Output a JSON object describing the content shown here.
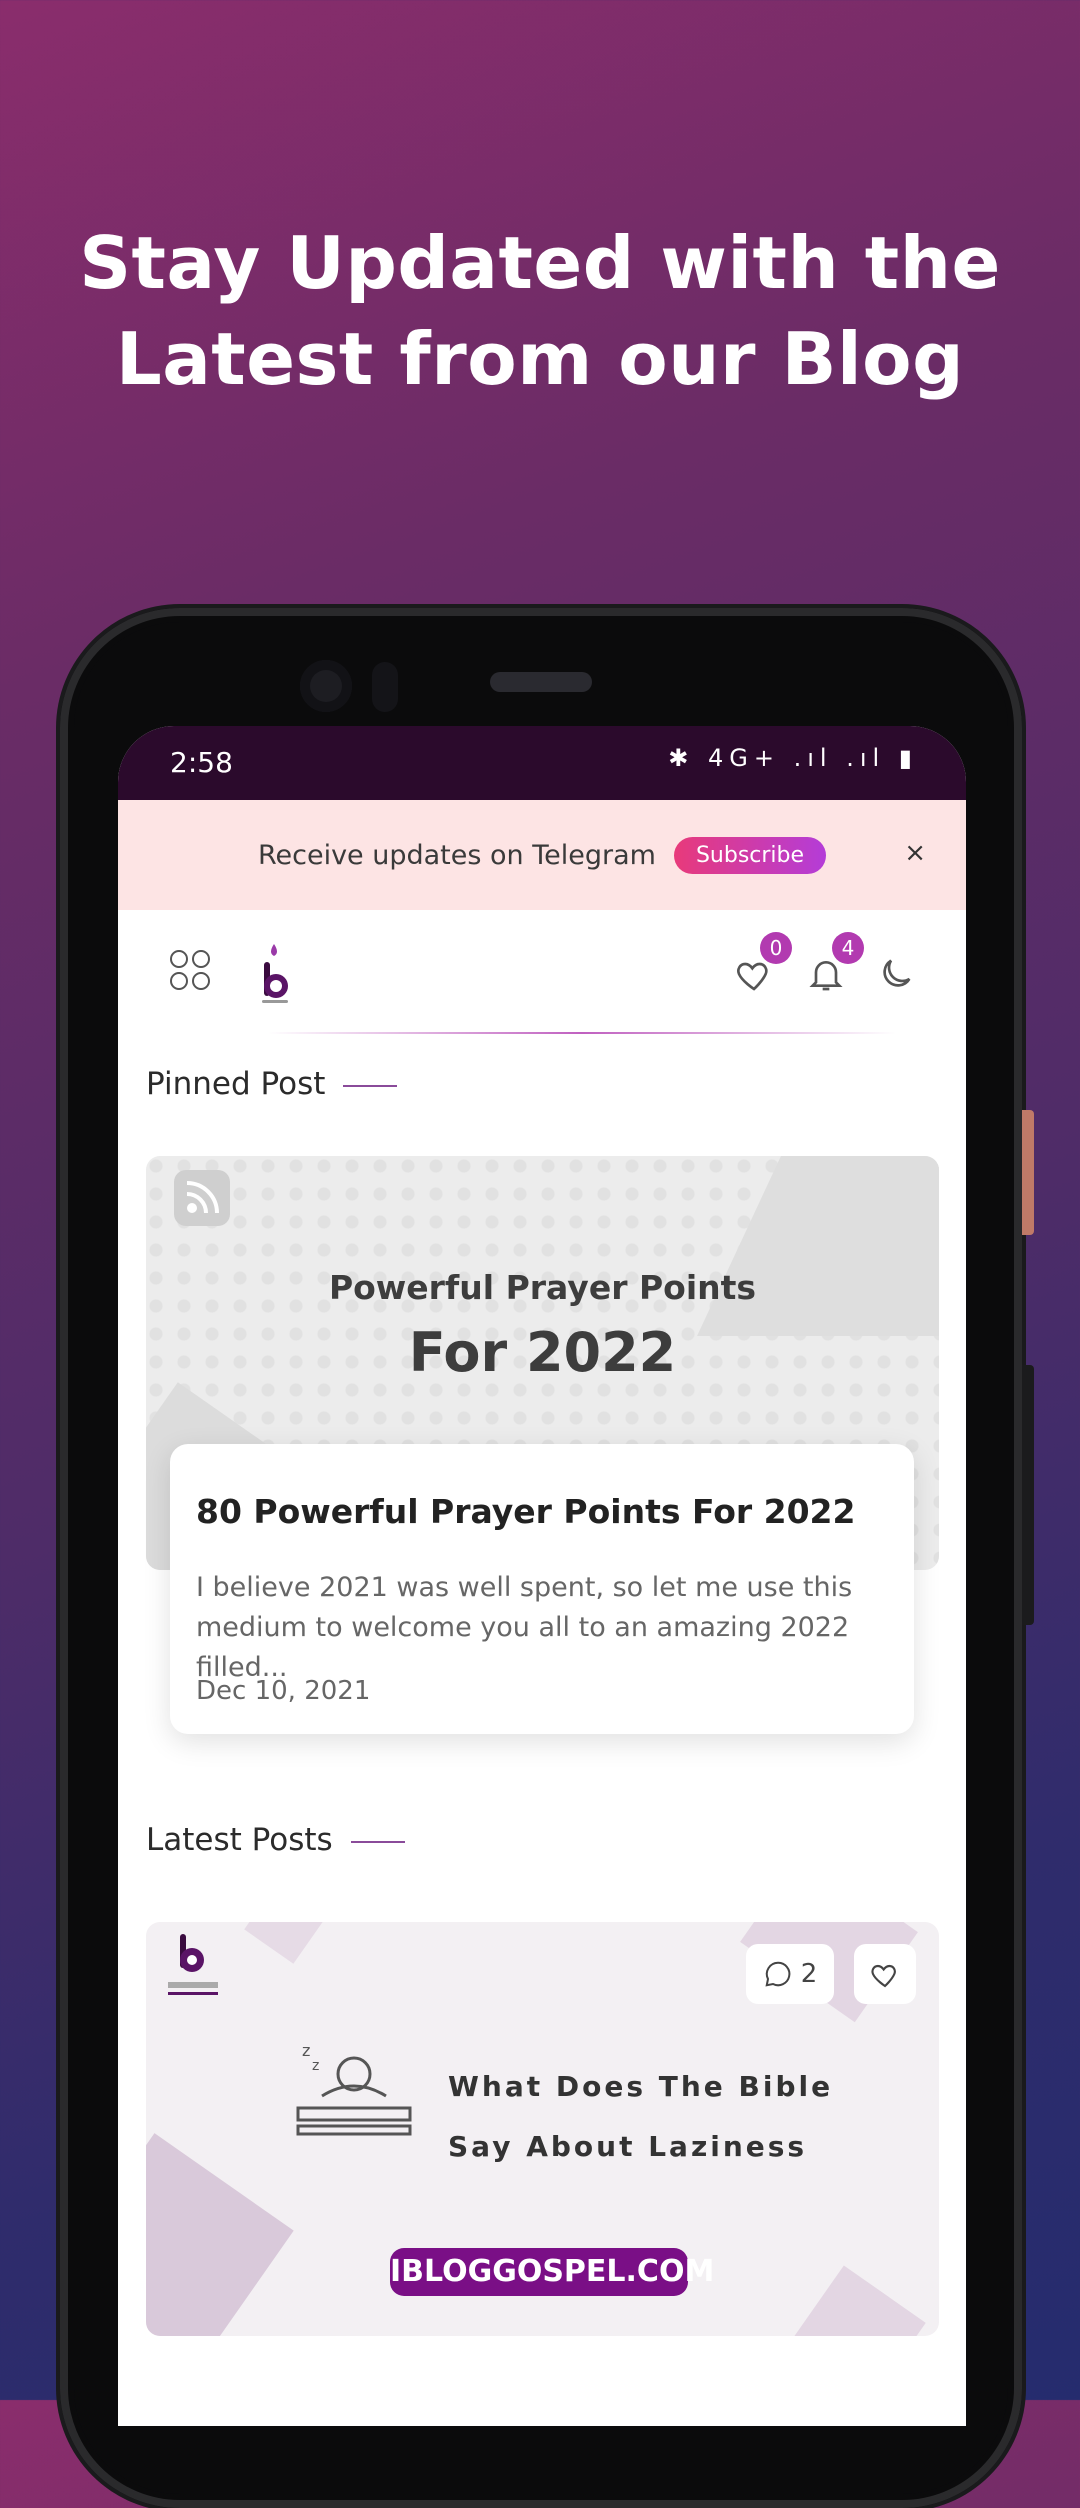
{
  "promo": {
    "headline_line1": "Stay Updated with the",
    "headline_line2": "Latest from our Blog"
  },
  "status_bar": {
    "time": "2:58",
    "icons_text": "✱ 4G+ .ıl .ıl ▮"
  },
  "telegram_banner": {
    "text": "Receive updates on Telegram",
    "subscribe_label": "Subscribe",
    "close_label": "×"
  },
  "app_bar": {
    "favorites_count": "0",
    "notifications_count": "4"
  },
  "pinned": {
    "section_title": "Pinned Post",
    "image_line1": "Powerful Prayer Points",
    "image_line2": "For 2022",
    "title": "80 Powerful Prayer Points For 2022",
    "excerpt": "I believe 2021 was well spent, so let me use this medium to welcome you all to an amazing 2022 filled...",
    "date": "Dec 10, 2021"
  },
  "latest": {
    "section_title": "Latest Posts",
    "image_line1": "What Does The Bible",
    "image_line2": "Say About Laziness",
    "image_domain": "IBLOGGOSPEL.COM",
    "comment_count": "2"
  },
  "colors": {
    "accent": "#b23ab0",
    "status_bar_bg": "#2b0a2c",
    "banner_bg": "#fde4e4"
  }
}
